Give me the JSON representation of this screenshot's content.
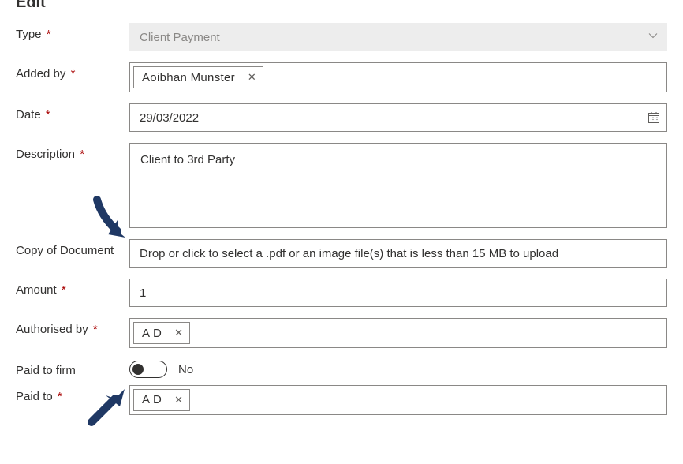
{
  "title": "Edit",
  "labels": {
    "type": "Type",
    "added_by": "Added by",
    "date": "Date",
    "description": "Description",
    "copy_of_document": "Copy of Document",
    "amount": "Amount",
    "authorised_by": "Authorised by",
    "paid_to_firm": "Paid to firm",
    "paid_to": "Paid to"
  },
  "values": {
    "type": "Client Payment",
    "added_by": "Aoibhan Munster",
    "date": "29/03/2022",
    "description": "Client to 3rd Party",
    "amount": "1",
    "authorised_by": "A D",
    "paid_to_firm_state": "No",
    "paid_to": "A D"
  },
  "hints": {
    "dropzone": "Drop or click to select a .pdf or an image file(s) that is less than 15 MB to upload"
  },
  "colors": {
    "arrow": "#1f3864",
    "required": "#a80000",
    "border": "#8a8886",
    "muted": "#8a8886"
  }
}
